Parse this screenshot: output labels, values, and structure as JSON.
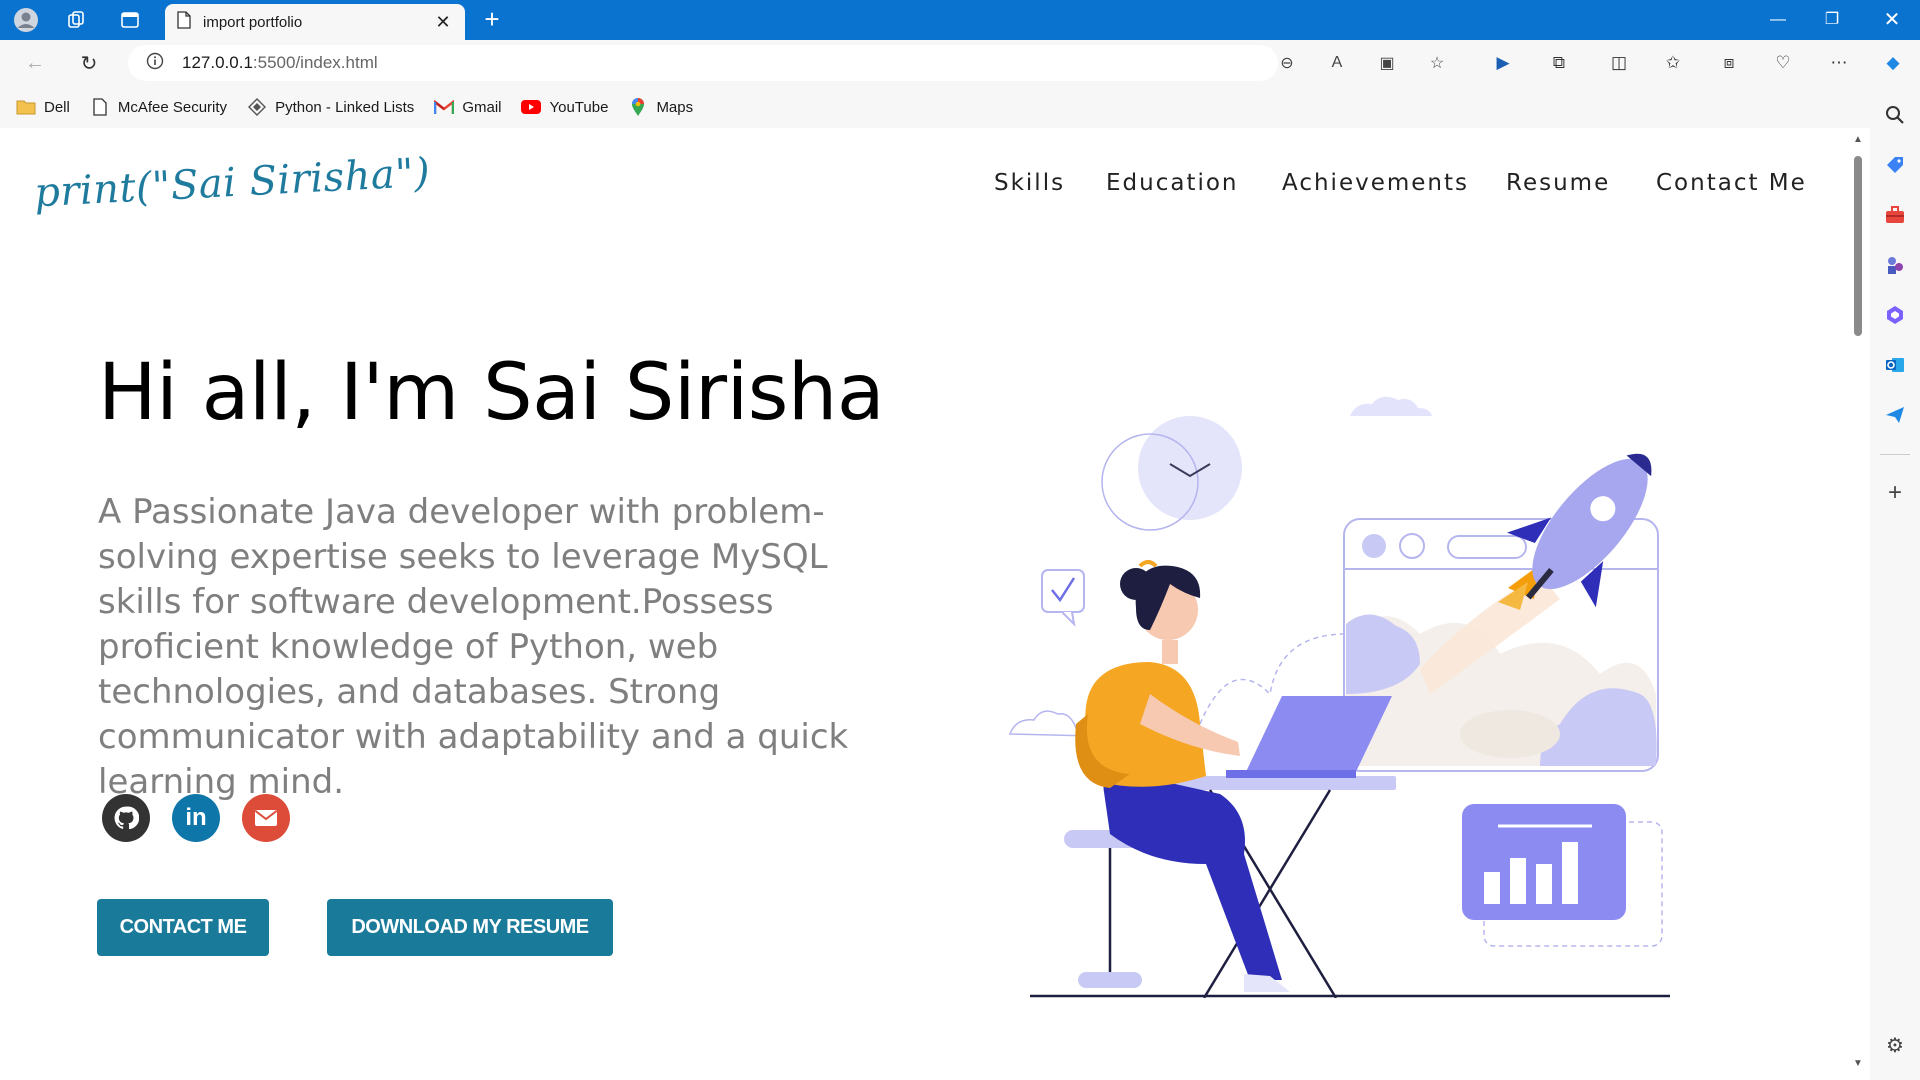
{
  "browser": {
    "tab_title": "import portfolio",
    "url_host": "127.0.0.1",
    "url_rest": ":5500/index.html",
    "bookmarks": [
      {
        "label": "Dell",
        "icon": "folder-icon"
      },
      {
        "label": "McAfee Security",
        "icon": "page-icon"
      },
      {
        "label": "Python - Linked Lists",
        "icon": "diamond-icon"
      },
      {
        "label": "Gmail",
        "icon": "gmail-icon"
      },
      {
        "label": "YouTube",
        "icon": "youtube-icon"
      },
      {
        "label": "Maps",
        "icon": "maps-pin-icon"
      }
    ],
    "accent_color": "#0a72cf"
  },
  "page": {
    "logo": "print(\"Sai Sirisha\")",
    "nav": [
      "Skills",
      "Education",
      "Achievements",
      "Resume",
      "Contact Me"
    ],
    "greeting": "Hi all, I'm Sai Sirisha",
    "bio": "A Passionate Java developer with problem-solving expertise seeks to leverage MySQL skills for software development.Possess proficient knowledge of Python, web technologies, and databases. Strong communicator with adaptability and a quick learning mind.",
    "social": [
      {
        "name": "github",
        "icon": "github-icon",
        "color": "#333333"
      },
      {
        "name": "linkedin",
        "icon": "linkedin-icon",
        "color": "#0e76a8",
        "glyph": "in"
      },
      {
        "name": "email",
        "icon": "envelope-icon",
        "color": "#dd4b39"
      }
    ],
    "buttons": {
      "contact": "CONTACT ME",
      "resume": "DOWNLOAD MY RESUME"
    },
    "brand_color": "#1a7a9a"
  }
}
